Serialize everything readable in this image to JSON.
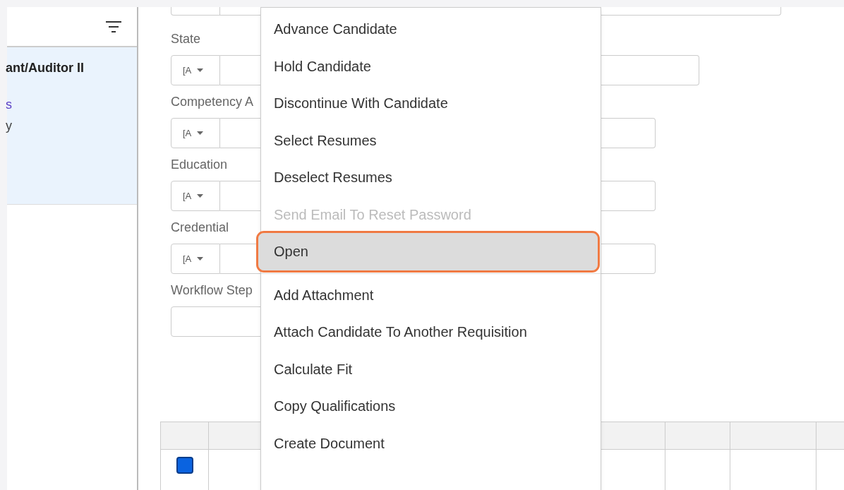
{
  "sidebar": {
    "items": [
      {
        "kind": "title",
        "text": "ant/Auditor II"
      },
      {
        "kind": "link",
        "text": "s"
      },
      {
        "kind": "text",
        "text": "y"
      }
    ]
  },
  "filters": [
    {
      "kind": "select_input",
      "label": "State",
      "select": "[A"
    },
    {
      "kind": "select_input",
      "label": "Competency A",
      "select": "[A"
    },
    {
      "kind": "select_input",
      "label": "Education",
      "select": "[A"
    },
    {
      "kind": "select_input",
      "label": "Credential",
      "select": "[A"
    },
    {
      "kind": "input",
      "label": "Workflow Step"
    }
  ],
  "menu": {
    "items": [
      {
        "kind": "item",
        "label": "Advance Candidate",
        "disabled": false,
        "selected": false
      },
      {
        "kind": "item",
        "label": "Hold Candidate",
        "disabled": false,
        "selected": false
      },
      {
        "kind": "item",
        "label": "Discontinue With Candidate",
        "disabled": false,
        "selected": false
      },
      {
        "kind": "item",
        "label": "Select Resumes",
        "disabled": false,
        "selected": false
      },
      {
        "kind": "item",
        "label": "Deselect Resumes",
        "disabled": false,
        "selected": false
      },
      {
        "kind": "item",
        "label": "Send Email To Reset Password",
        "disabled": true,
        "selected": false
      },
      {
        "kind": "item",
        "label": "Open",
        "disabled": false,
        "selected": true
      },
      {
        "kind": "separator"
      },
      {
        "kind": "item",
        "label": "Add Attachment",
        "disabled": false,
        "selected": false
      },
      {
        "kind": "item",
        "label": "Attach Candidate To Another Requisition",
        "disabled": false,
        "selected": false
      },
      {
        "kind": "item",
        "label": "Calculate Fit",
        "disabled": false,
        "selected": false
      },
      {
        "kind": "item",
        "label": "Copy Qualifications",
        "disabled": false,
        "selected": false
      },
      {
        "kind": "item",
        "label": "Create Document",
        "disabled": false,
        "selected": false
      }
    ]
  },
  "table": {
    "rows": [
      {
        "checked": true
      }
    ]
  }
}
